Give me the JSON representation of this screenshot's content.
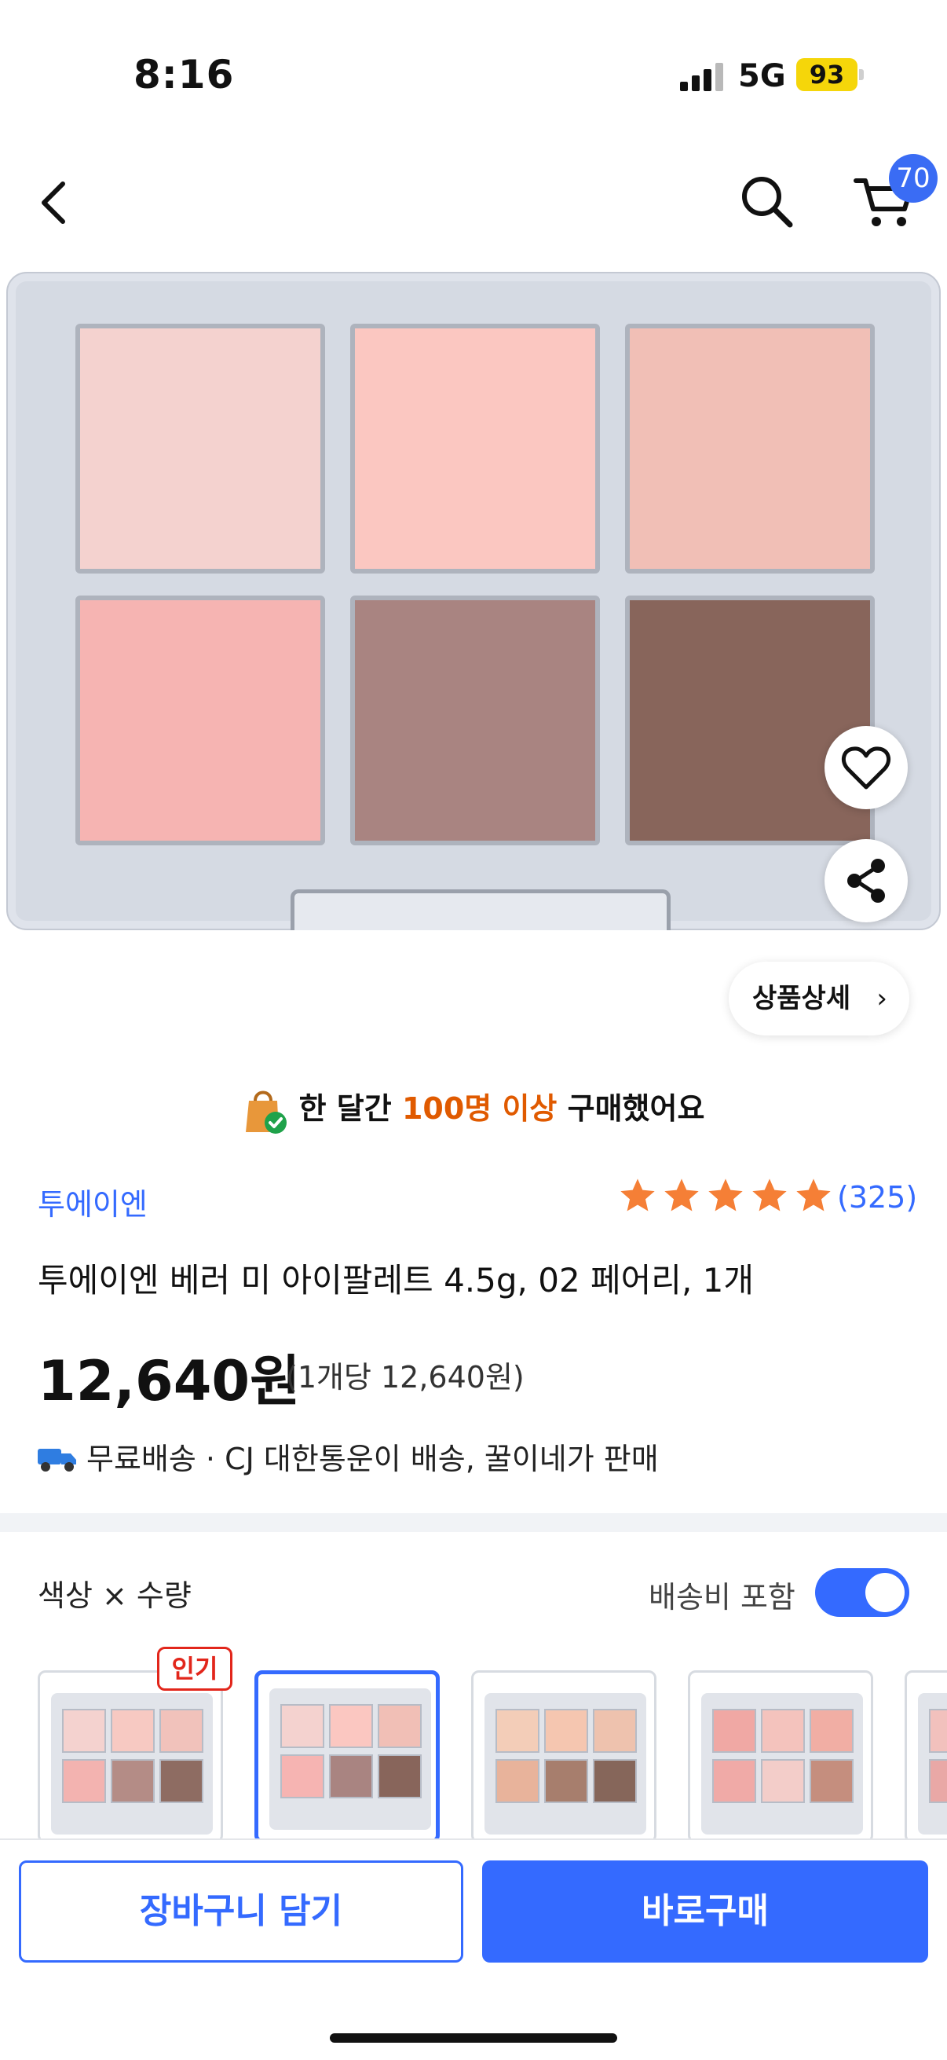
{
  "status_bar": {
    "time": "8:16",
    "network": "5G",
    "battery": "93"
  },
  "header": {
    "cart_count": "70"
  },
  "detail_button": {
    "label": "상품상세",
    "chevron": "›"
  },
  "social_proof": {
    "prefix": "한 달간 ",
    "highlight": "100명 이상",
    "suffix": " 구매했어요"
  },
  "product": {
    "brand": "투에이엔",
    "rating": {
      "stars": 5,
      "count_label": "(325)"
    },
    "title": "투에이엔 베러 미 아이팔레트 4.5g, 02 페어리, 1개",
    "price": "12,640원",
    "unit_price": "(1개당 12,640원)",
    "shipping": "무료배송 · CJ 대한통운이 배송, 꿀이네가 판매"
  },
  "options": {
    "title": "색상 × 수량",
    "shipping_toggle_label": "배송비 포함",
    "shipping_toggle_on": true,
    "popular_badge": "인기"
  },
  "palette_colors": [
    "#f4d2cf",
    "#fbc7c1",
    "#f1bfb6",
    "#f6b4b2",
    "#a98481",
    "#88655b"
  ],
  "bottom": {
    "add_to_cart": "장바구니 담기",
    "buy_now": "바로구매"
  },
  "colors": {
    "accent": "#346aff",
    "highlight": "#e05a00",
    "star": "#f57f36",
    "badge_red": "#e2261b"
  }
}
